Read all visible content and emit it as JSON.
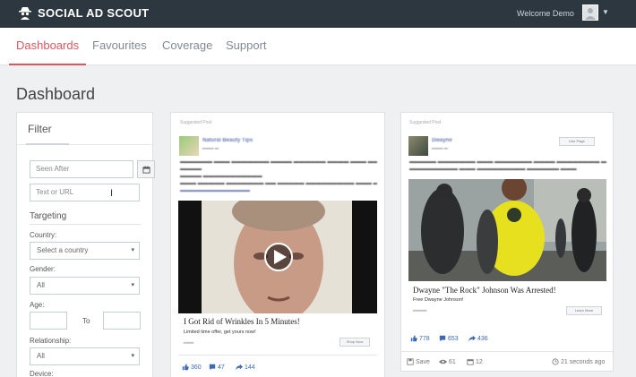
{
  "app": {
    "brand": "SOCIAL AD SCOUT",
    "welcome": "Welcome Demo"
  },
  "nav": {
    "items": [
      {
        "label": "Dashboards",
        "active": true
      },
      {
        "label": "Favourites",
        "active": false
      },
      {
        "label": "Coverage",
        "active": false
      },
      {
        "label": "Support",
        "active": false
      }
    ]
  },
  "page": {
    "title": "Dashboard"
  },
  "filter": {
    "title": "Filter",
    "seen_after_placeholder": "Seen After",
    "text_url_placeholder": "Text or URL",
    "targeting_title": "Targeting",
    "country_label": "Country:",
    "country_value": "Select a country",
    "gender_label": "Gender:",
    "gender_value": "All",
    "age_label": "Age:",
    "age_to": "To",
    "relationship_label": "Relationship:",
    "relationship_value": "All",
    "device_label": "Device:"
  },
  "ads": [
    {
      "sponsored": "Suggested Post",
      "page_name": "Natural Beauty Tips",
      "headline": "I Got Rid of Wrinkles In 5 Minutes!",
      "description": "Limited time offer, get yours now!",
      "cta": "Shop Now",
      "likes": "360",
      "comments": "47",
      "shares": "144"
    },
    {
      "sponsored": "Suggested Post",
      "page_name": "Dwayne",
      "headline": "Dwayne \"The Rock\" Johnson Was Arrested!",
      "description": "Free Dwayne Johnson!",
      "cta": "Learn More",
      "like_page": "Like Page",
      "likes": "778",
      "comments": "653",
      "shares": "436",
      "save": "Save",
      "views": "61",
      "days": "12",
      "time_ago": "21 seconds ago"
    }
  ],
  "colors": {
    "topbar": "#2c3740",
    "accent": "#e0565e",
    "link": "#3b69b4"
  }
}
